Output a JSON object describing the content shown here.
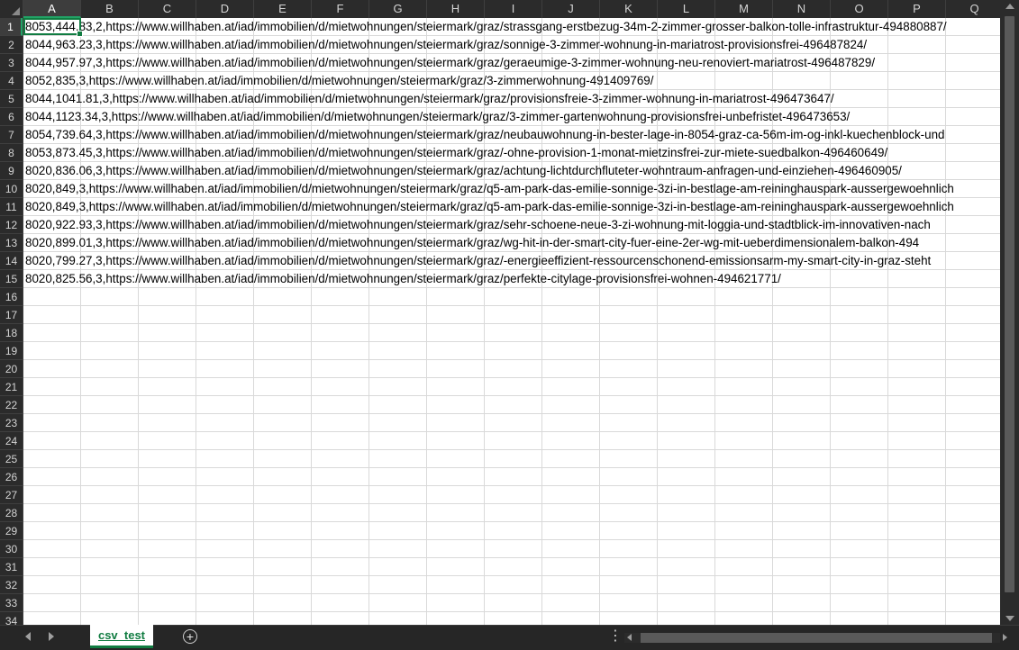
{
  "sheet": {
    "columns": [
      "A",
      "B",
      "C",
      "D",
      "E",
      "F",
      "G",
      "H",
      "I",
      "J",
      "K",
      "L",
      "M",
      "N",
      "O",
      "P",
      "Q"
    ],
    "row_numbers": [
      "1",
      "2",
      "3",
      "4",
      "5",
      "6",
      "7",
      "8",
      "9",
      "10",
      "11",
      "12",
      "13",
      "14",
      "15",
      "16",
      "17",
      "18",
      "19",
      "20",
      "21",
      "22",
      "23",
      "24",
      "25",
      "26",
      "27",
      "28",
      "29",
      "30",
      "31",
      "32",
      "33",
      "34"
    ],
    "selected_column": "A",
    "selected_row": "1",
    "rows": [
      "8053,444.83,2,https://www.willhaben.at/iad/immobilien/d/mietwohnungen/steiermark/graz/strassgang-erstbezug-34m-2-zimmer-grosser-balkon-tolle-infrastruktur-494880887/",
      "8044,963.23,3,https://www.willhaben.at/iad/immobilien/d/mietwohnungen/steiermark/graz/sonnige-3-zimmer-wohnung-in-mariatrost-provisionsfrei-496487824/",
      "8044,957.97,3,https://www.willhaben.at/iad/immobilien/d/mietwohnungen/steiermark/graz/geraeumige-3-zimmer-wohnung-neu-renoviert-mariatrost-496487829/",
      "8052,835,3,https://www.willhaben.at/iad/immobilien/d/mietwohnungen/steiermark/graz/3-zimmerwohnung-491409769/",
      "8044,1041.81,3,https://www.willhaben.at/iad/immobilien/d/mietwohnungen/steiermark/graz/provisionsfreie-3-zimmer-wohnung-in-mariatrost-496473647/",
      "8044,1123.34,3,https://www.willhaben.at/iad/immobilien/d/mietwohnungen/steiermark/graz/3-zimmer-gartenwohnung-provisionsfrei-unbefristet-496473653/",
      "8054,739.64,3,https://www.willhaben.at/iad/immobilien/d/mietwohnungen/steiermark/graz/neubauwohnung-in-bester-lage-in-8054-graz-ca-56m-im-og-inkl-kuechenblock-und",
      "8053,873.45,3,https://www.willhaben.at/iad/immobilien/d/mietwohnungen/steiermark/graz/-ohne-provision-1-monat-mietzinsfrei-zur-miete-suedbalkon-496460649/",
      "8020,836.06,3,https://www.willhaben.at/iad/immobilien/d/mietwohnungen/steiermark/graz/achtung-lichtdurchfluteter-wohntraum-anfragen-und-einziehen-496460905/",
      "8020,849,3,https://www.willhaben.at/iad/immobilien/d/mietwohnungen/steiermark/graz/q5-am-park-das-emilie-sonnige-3zi-in-bestlage-am-reininghauspark-aussergewoehnlich",
      "8020,849,3,https://www.willhaben.at/iad/immobilien/d/mietwohnungen/steiermark/graz/q5-am-park-das-emilie-sonnige-3zi-in-bestlage-am-reininghauspark-aussergewoehnlich",
      "8020,922.93,3,https://www.willhaben.at/iad/immobilien/d/mietwohnungen/steiermark/graz/sehr-schoene-neue-3-zi-wohnung-mit-loggia-und-stadtblick-im-innovativen-nach",
      "8020,899.01,3,https://www.willhaben.at/iad/immobilien/d/mietwohnungen/steiermark/graz/wg-hit-in-der-smart-city-fuer-eine-2er-wg-mit-ueberdimensionalem-balkon-494",
      "8020,799.27,3,https://www.willhaben.at/iad/immobilien/d/mietwohnungen/steiermark/graz/-energieeffizient-ressourcenschonend-emissionsarm-my-smart-city-in-graz-steht",
      "8020,825.56,3,https://www.willhaben.at/iad/immobilien/d/mietwohnungen/steiermark/graz/perfekte-citylage-provisionsfrei-wohnen-494621771/"
    ]
  },
  "tabs": {
    "active": "csv_test",
    "add_symbol": "+",
    "more_symbol": "⋮"
  }
}
